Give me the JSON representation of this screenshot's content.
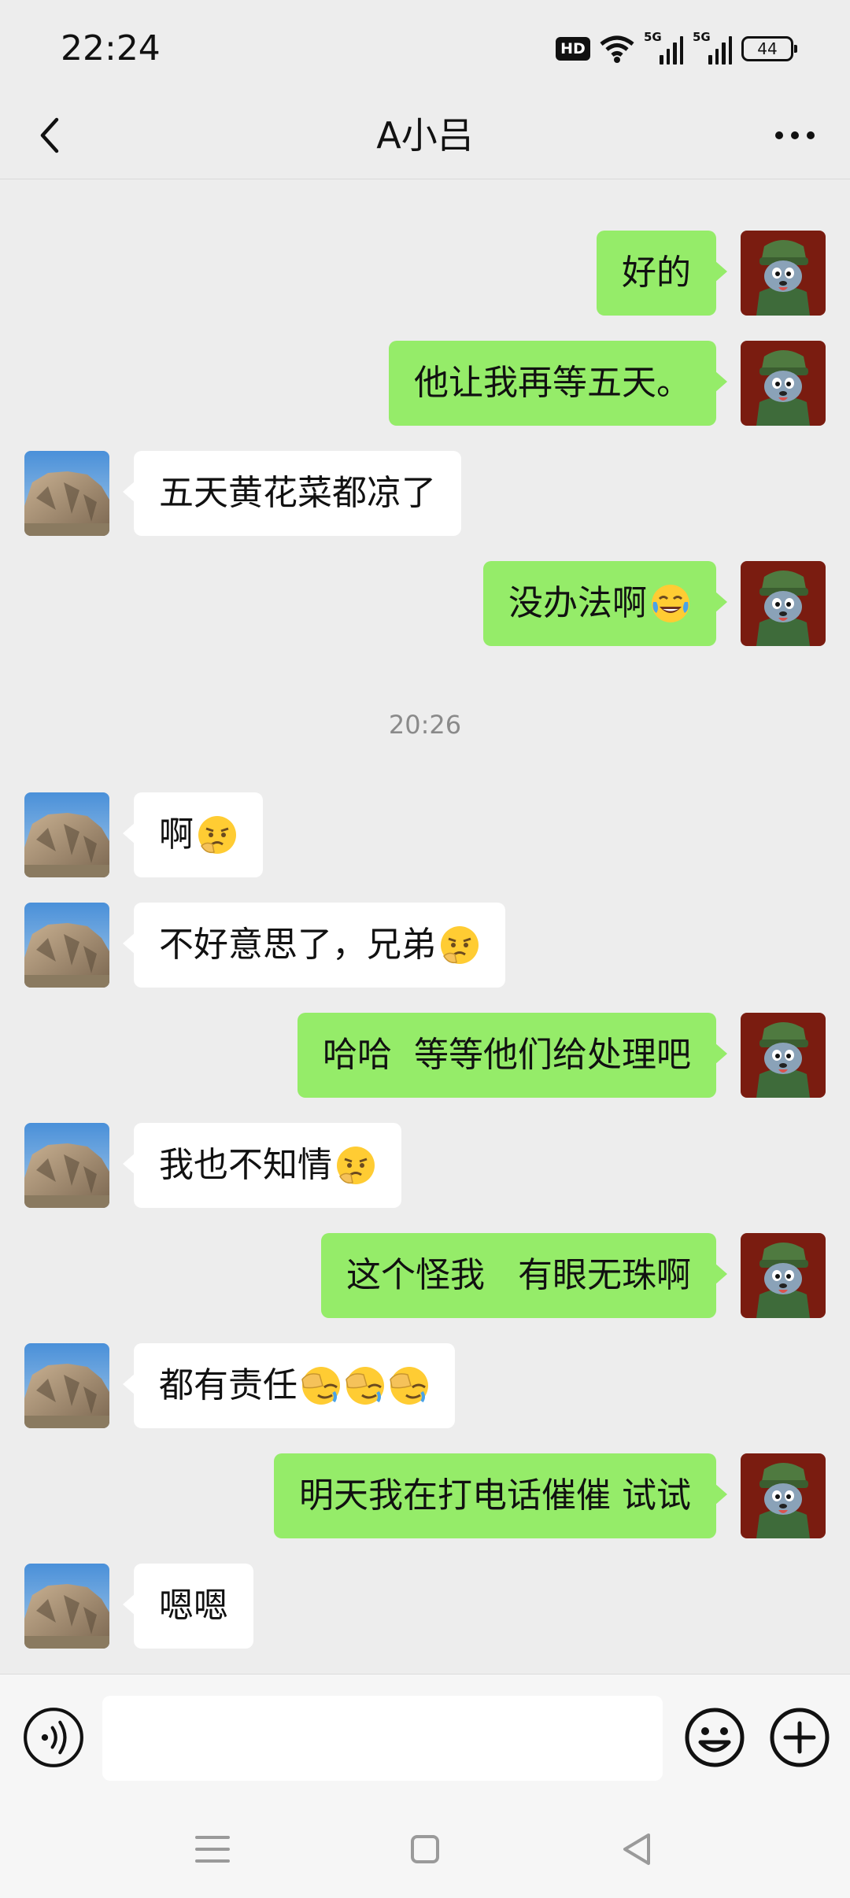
{
  "status_bar": {
    "time": "22:24",
    "hd_label": "HD",
    "signal_label_1": "5G",
    "signal_label_2": "5G",
    "battery": "44"
  },
  "header": {
    "title": "A小吕",
    "back_icon": "chevron-left-icon",
    "more_icon": "more-dots-icon"
  },
  "messages": [
    {
      "from": "me",
      "text": "好的"
    },
    {
      "from": "me",
      "text": "他让我再等五天。"
    },
    {
      "from": "them",
      "text": "五天黄花菜都凉了"
    },
    {
      "from": "me",
      "text": "没办法啊",
      "emoji": [
        "tears-of-joy"
      ]
    },
    {
      "type": "time",
      "text": "20:26"
    },
    {
      "from": "them",
      "text": "啊",
      "emoji": [
        "sad-thinking"
      ]
    },
    {
      "from": "them",
      "text": "不好意思了，兄弟",
      "emoji": [
        "sad-thinking"
      ]
    },
    {
      "from": "me",
      "text": "哈哈  等等他们给处理吧"
    },
    {
      "from": "them",
      "text": "我也不知情",
      "emoji": [
        "sad-thinking"
      ]
    },
    {
      "from": "me",
      "text": "这个怪我   有眼无珠啊"
    },
    {
      "from": "them",
      "text": "都有责任",
      "emoji": [
        "facepalm",
        "facepalm",
        "facepalm"
      ]
    },
    {
      "from": "me",
      "text": "明天我在打电话催催 试试"
    },
    {
      "from": "them",
      "text": "嗯嗯"
    }
  ],
  "input_bar": {
    "text_value": "",
    "voice_icon": "voice-icon",
    "emoji_icon": "smiley-icon",
    "plus_icon": "plus-icon"
  },
  "colors": {
    "background": "#ededed",
    "my_bubble": "#95ec69",
    "their_bubble": "#ffffff"
  }
}
